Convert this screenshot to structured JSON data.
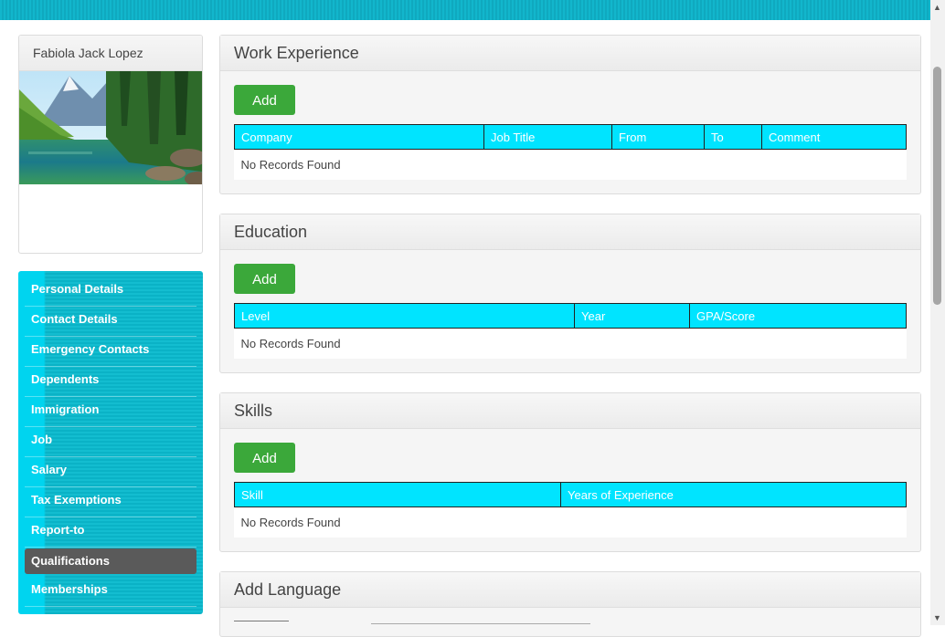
{
  "profile": {
    "name": "Fabiola Jack Lopez"
  },
  "menu": {
    "items": [
      {
        "label": "Personal Details"
      },
      {
        "label": "Contact Details"
      },
      {
        "label": "Emergency Contacts"
      },
      {
        "label": "Dependents"
      },
      {
        "label": "Immigration"
      },
      {
        "label": "Job"
      },
      {
        "label": "Salary"
      },
      {
        "label": "Tax Exemptions"
      },
      {
        "label": "Report-to"
      },
      {
        "label": "Qualifications",
        "active": true
      },
      {
        "label": "Memberships"
      }
    ]
  },
  "work_experience": {
    "title": "Work Experience",
    "add_label": "Add",
    "columns": [
      "Company",
      "Job Title",
      "From",
      "To",
      "Comment"
    ],
    "empty": "No Records Found"
  },
  "education": {
    "title": "Education",
    "add_label": "Add",
    "columns": [
      "Level",
      "Year",
      "GPA/Score"
    ],
    "empty": "No Records Found"
  },
  "skills": {
    "title": "Skills",
    "add_label": "Add",
    "columns": [
      "Skill",
      "Years of Experience"
    ],
    "empty": "No Records Found"
  },
  "language": {
    "title": "Add Language"
  },
  "colors": {
    "accent": "#00e4ff",
    "menu_bg": "#13bdd0",
    "active_menu": "#5a5a5a",
    "add_button": "#3ba83a"
  }
}
